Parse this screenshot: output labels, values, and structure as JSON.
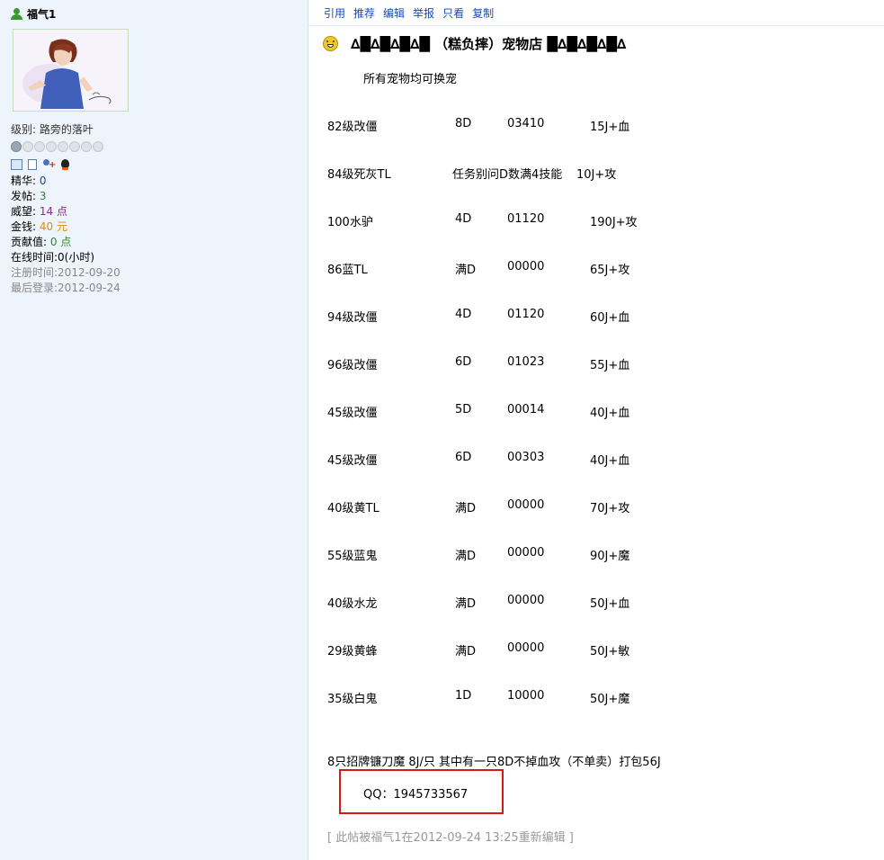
{
  "user": {
    "name": "福气1",
    "level_label": "级别:",
    "level_value": "路旁的落叶",
    "rank_stars_filled": 1,
    "rank_stars_total": 8,
    "stats": {
      "jinghua_label": "精华:",
      "jinghua_value": "0",
      "fatie_label": "发帖:",
      "fatie_value": "3",
      "weiwang_label": "威望:",
      "weiwang_value": "14 点",
      "jinqian_label": "金钱:",
      "jinqian_value": "40 元",
      "gongxian_label": "贡献值:",
      "gongxian_value": "0 点",
      "online": "在线时间:0(小时)",
      "register": "注册时间:2012-09-20",
      "lastlogin": "最后登录:2012-09-24"
    }
  },
  "actions": [
    "引用",
    "推荐",
    "编辑",
    "举报",
    "只看",
    "复制"
  ],
  "post": {
    "title": "∆█∆█∆█∆█ （糕负摔）宠物店 █∆█∆█∆█∆",
    "intro": "所有宠物均可换宠",
    "rows": [
      [
        "82级改僵",
        "8D",
        "03410",
        "15J+血"
      ],
      [
        "84级死灰TL",
        "任务别问D数满4技能",
        "",
        "10J+攻"
      ],
      [
        "100水驴",
        "4D",
        "01120",
        "190J+攻"
      ],
      [
        "86蓝TL",
        "满D",
        "00000",
        "65J+攻"
      ],
      [
        "94级改僵",
        "4D",
        "01120",
        "60J+血"
      ],
      [
        "96级改僵",
        "6D",
        "01023",
        "55J+血"
      ],
      [
        "45级改僵",
        "5D",
        "00014",
        "40J+血"
      ],
      [
        "45级改僵",
        "6D",
        "00303",
        "40J+血"
      ],
      [
        "40级黄TL",
        "满D",
        "00000",
        "70J+攻"
      ],
      [
        "55级蓝鬼",
        "满D",
        "00000",
        "90J+魔"
      ],
      [
        "40级水龙",
        "满D",
        "00000",
        "50J+血"
      ],
      [
        "29级黄蜂",
        "满D",
        "00000",
        "50J+敏"
      ],
      [
        "35级白鬼",
        "1D",
        "10000",
        "50J+魔"
      ]
    ],
    "bundle": "8只招牌镰刀魔    8J/只    其中有一只8D不掉血攻（不单卖）打包56J",
    "qq": "QQ：1945733567",
    "edit_note": "[ 此帖被福气1在2012-09-24 13:25重新编辑 ]"
  },
  "colors": {
    "link": "#1a4ab8",
    "highlight_box": "#d8191a",
    "sidebar_bg": "#eef4fb"
  }
}
